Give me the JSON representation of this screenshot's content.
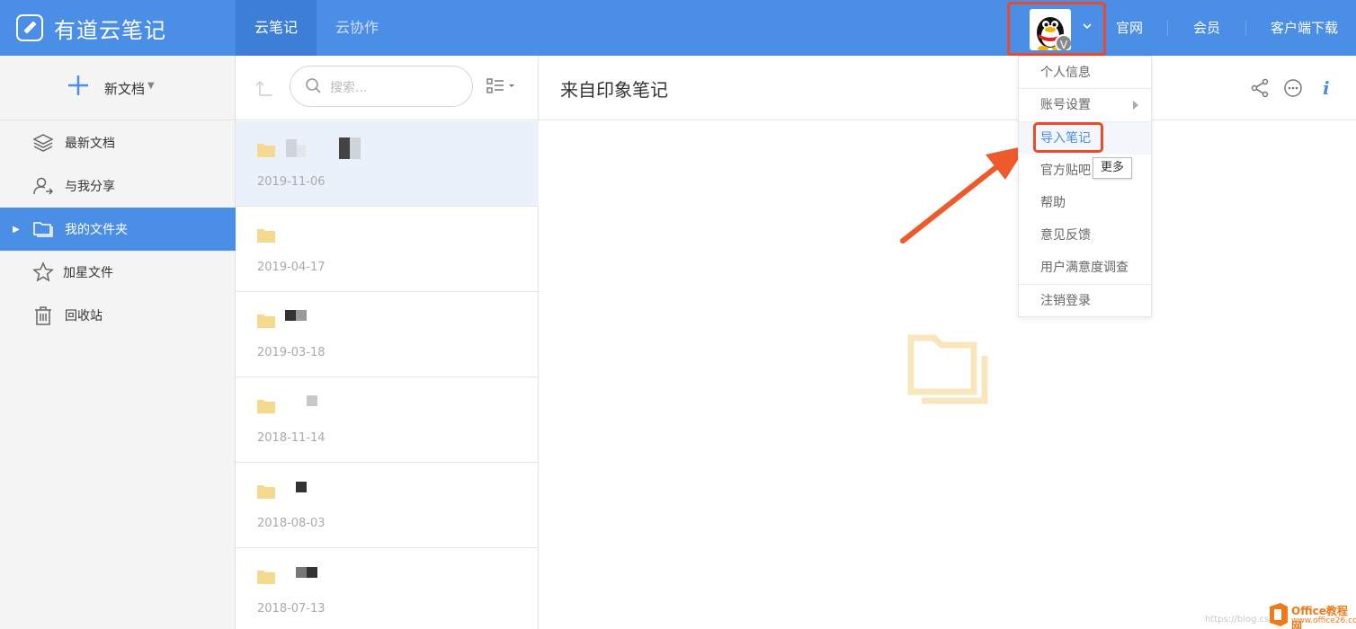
{
  "app": {
    "title": "有道云笔记"
  },
  "topbar": {
    "tabs": [
      {
        "label": "云笔记",
        "active": true
      },
      {
        "label": "云协作",
        "active": false
      }
    ],
    "avatar_badge": "V",
    "links": [
      "官网",
      "会员",
      "客户端下载"
    ]
  },
  "sidebar": {
    "new_doc_label": "新文档",
    "items": [
      {
        "label": "最新文档",
        "icon": "layers-icon"
      },
      {
        "label": "与我分享",
        "icon": "share-user-icon"
      },
      {
        "label": "我的文件夹",
        "icon": "folder-icon",
        "active": true
      },
      {
        "label": "加星文件",
        "icon": "star-icon"
      },
      {
        "label": "回收站",
        "icon": "trash-icon"
      }
    ]
  },
  "list": {
    "search_placeholder": "搜索...",
    "rows": [
      {
        "date": "2019-11-06",
        "selected": true
      },
      {
        "date": "2019-04-17"
      },
      {
        "date": "2019-03-18"
      },
      {
        "date": "2018-11-14"
      },
      {
        "date": "2018-08-03"
      },
      {
        "date": "2018-07-13"
      }
    ]
  },
  "main": {
    "title": "来自印象笔记"
  },
  "dropdown": {
    "items": [
      "个人信息",
      "账号设置",
      "导入笔记",
      "官方贴吧",
      "帮助",
      "意见反馈",
      "用户满意度调查",
      "注销登录"
    ],
    "tooltip": "更多"
  },
  "watermark": {
    "url": "https://blog.csdn",
    "brand": "Office教程网",
    "site": "www.office26.com"
  },
  "colors": {
    "accent": "#4a8ee6",
    "highlight": "#e74c2e",
    "folder": "#f5d98e"
  }
}
